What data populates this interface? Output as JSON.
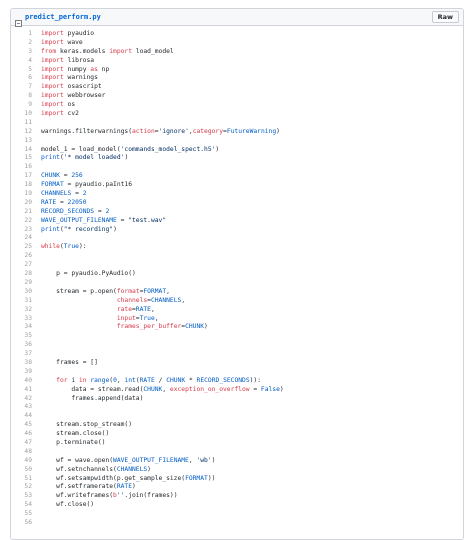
{
  "file": {
    "name": "predict_perform.py",
    "raw_label": "Raw"
  },
  "colors": {
    "keyword": "#d73a49",
    "constant": "#005cc5",
    "string": "#032f62",
    "text": "#24292e",
    "filename": "#0366d6"
  },
  "code_lines": [
    {
      "n": "1",
      "t": [
        {
          "k": "k",
          "s": "import"
        },
        {
          "k": "",
          "s": " pyaudio"
        }
      ]
    },
    {
      "n": "2",
      "t": [
        {
          "k": "k",
          "s": "import"
        },
        {
          "k": "",
          "s": " wave"
        }
      ]
    },
    {
      "n": "3",
      "t": [
        {
          "k": "k",
          "s": "from"
        },
        {
          "k": "",
          "s": " keras.models "
        },
        {
          "k": "k",
          "s": "import"
        },
        {
          "k": "",
          "s": " load_model"
        }
      ]
    },
    {
      "n": "4",
      "t": [
        {
          "k": "k",
          "s": "import"
        },
        {
          "k": "",
          "s": " librosa"
        }
      ]
    },
    {
      "n": "5",
      "t": [
        {
          "k": "k",
          "s": "import"
        },
        {
          "k": "",
          "s": " numpy "
        },
        {
          "k": "k",
          "s": "as"
        },
        {
          "k": "",
          "s": " np"
        }
      ]
    },
    {
      "n": "6",
      "t": [
        {
          "k": "k",
          "s": "import"
        },
        {
          "k": "",
          "s": " warnings"
        }
      ]
    },
    {
      "n": "7",
      "t": [
        {
          "k": "k",
          "s": "import"
        },
        {
          "k": "",
          "s": " osascript"
        }
      ]
    },
    {
      "n": "8",
      "t": [
        {
          "k": "k",
          "s": "import"
        },
        {
          "k": "",
          "s": " webbrowser"
        }
      ]
    },
    {
      "n": "9",
      "t": [
        {
          "k": "k",
          "s": "import"
        },
        {
          "k": "",
          "s": " os"
        }
      ]
    },
    {
      "n": "10",
      "t": [
        {
          "k": "k",
          "s": "import"
        },
        {
          "k": "",
          "s": " cv2"
        }
      ]
    },
    {
      "n": "11",
      "t": []
    },
    {
      "n": "12",
      "t": [
        {
          "k": "",
          "s": "warnings.filterwarnings("
        },
        {
          "k": "k",
          "s": "action"
        },
        {
          "k": "",
          "s": "="
        },
        {
          "k": "s",
          "s": "'ignore'"
        },
        {
          "k": "",
          "s": ","
        },
        {
          "k": "k",
          "s": "category"
        },
        {
          "k": "",
          "s": "="
        },
        {
          "k": "c",
          "s": "FutureWarning"
        },
        {
          "k": "",
          "s": ")"
        }
      ]
    },
    {
      "n": "13",
      "t": []
    },
    {
      "n": "14",
      "t": [
        {
          "k": "",
          "s": "model_1 = load_model("
        },
        {
          "k": "s",
          "s": "'commands_model_spect.h5'"
        },
        {
          "k": "",
          "s": ")"
        }
      ]
    },
    {
      "n": "15",
      "t": [
        {
          "k": "c",
          "s": "print"
        },
        {
          "k": "",
          "s": "("
        },
        {
          "k": "s",
          "s": "'* model loaded'"
        },
        {
          "k": "",
          "s": ")"
        }
      ]
    },
    {
      "n": "16",
      "t": []
    },
    {
      "n": "17",
      "t": [
        {
          "k": "c",
          "s": "CHUNK"
        },
        {
          "k": "",
          "s": " = "
        },
        {
          "k": "c",
          "s": "256"
        }
      ]
    },
    {
      "n": "18",
      "t": [
        {
          "k": "c",
          "s": "FORMAT"
        },
        {
          "k": "",
          "s": " = pyaudio.paInt16"
        }
      ]
    },
    {
      "n": "19",
      "t": [
        {
          "k": "c",
          "s": "CHANNELS"
        },
        {
          "k": "",
          "s": " = "
        },
        {
          "k": "c",
          "s": "2"
        }
      ]
    },
    {
      "n": "20",
      "t": [
        {
          "k": "c",
          "s": "RATE"
        },
        {
          "k": "",
          "s": " = "
        },
        {
          "k": "c",
          "s": "22050"
        }
      ]
    },
    {
      "n": "21",
      "t": [
        {
          "k": "c",
          "s": "RECORD_SECONDS"
        },
        {
          "k": "",
          "s": " = "
        },
        {
          "k": "c",
          "s": "2"
        }
      ]
    },
    {
      "n": "22",
      "t": [
        {
          "k": "c",
          "s": "WAVE_OUTPUT_FILENAME"
        },
        {
          "k": "",
          "s": " = "
        },
        {
          "k": "s",
          "s": "\"test.wav\""
        }
      ]
    },
    {
      "n": "23",
      "t": [
        {
          "k": "c",
          "s": "print"
        },
        {
          "k": "",
          "s": "("
        },
        {
          "k": "s",
          "s": "\"* recording\""
        },
        {
          "k": "",
          "s": ")"
        }
      ]
    },
    {
      "n": "24",
      "t": []
    },
    {
      "n": "25",
      "t": [
        {
          "k": "k",
          "s": "while"
        },
        {
          "k": "",
          "s": "("
        },
        {
          "k": "c",
          "s": "True"
        },
        {
          "k": "",
          "s": "):"
        }
      ]
    },
    {
      "n": "26",
      "t": []
    },
    {
      "n": "27",
      "t": []
    },
    {
      "n": "28",
      "t": [
        {
          "k": "",
          "s": "    p = pyaudio.PyAudio()"
        }
      ]
    },
    {
      "n": "29",
      "t": []
    },
    {
      "n": "30",
      "t": [
        {
          "k": "",
          "s": "    stream = p.open("
        },
        {
          "k": "k",
          "s": "format"
        },
        {
          "k": "",
          "s": "="
        },
        {
          "k": "c",
          "s": "FORMAT"
        },
        {
          "k": "",
          "s": ","
        }
      ]
    },
    {
      "n": "31",
      "t": [
        {
          "k": "",
          "s": "                    "
        },
        {
          "k": "k",
          "s": "channels"
        },
        {
          "k": "",
          "s": "="
        },
        {
          "k": "c",
          "s": "CHANNELS"
        },
        {
          "k": "",
          "s": ","
        }
      ]
    },
    {
      "n": "32",
      "t": [
        {
          "k": "",
          "s": "                    "
        },
        {
          "k": "k",
          "s": "rate"
        },
        {
          "k": "",
          "s": "="
        },
        {
          "k": "c",
          "s": "RATE"
        },
        {
          "k": "",
          "s": ","
        }
      ]
    },
    {
      "n": "33",
      "t": [
        {
          "k": "",
          "s": "                    "
        },
        {
          "k": "k",
          "s": "input"
        },
        {
          "k": "",
          "s": "="
        },
        {
          "k": "c",
          "s": "True"
        },
        {
          "k": "",
          "s": ","
        }
      ]
    },
    {
      "n": "34",
      "t": [
        {
          "k": "",
          "s": "                    "
        },
        {
          "k": "k",
          "s": "frames_per_buffer"
        },
        {
          "k": "",
          "s": "="
        },
        {
          "k": "c",
          "s": "CHUNK"
        },
        {
          "k": "",
          "s": ")"
        }
      ]
    },
    {
      "n": "35",
      "t": []
    },
    {
      "n": "36",
      "t": []
    },
    {
      "n": "37",
      "t": []
    },
    {
      "n": "38",
      "t": [
        {
          "k": "",
          "s": "    frames = []"
        }
      ]
    },
    {
      "n": "39",
      "t": []
    },
    {
      "n": "40",
      "t": [
        {
          "k": "",
          "s": "    "
        },
        {
          "k": "k",
          "s": "for"
        },
        {
          "k": "",
          "s": " i "
        },
        {
          "k": "k",
          "s": "in"
        },
        {
          "k": "",
          "s": " "
        },
        {
          "k": "c",
          "s": "range"
        },
        {
          "k": "",
          "s": "("
        },
        {
          "k": "c",
          "s": "0"
        },
        {
          "k": "",
          "s": ", "
        },
        {
          "k": "c",
          "s": "int"
        },
        {
          "k": "",
          "s": "("
        },
        {
          "k": "c",
          "s": "RATE"
        },
        {
          "k": "",
          "s": " / "
        },
        {
          "k": "c",
          "s": "CHUNK"
        },
        {
          "k": "",
          "s": " * "
        },
        {
          "k": "c",
          "s": "RECORD_SECONDS"
        },
        {
          "k": "",
          "s": ")):"
        }
      ]
    },
    {
      "n": "41",
      "t": [
        {
          "k": "",
          "s": "        data = stream.read("
        },
        {
          "k": "c",
          "s": "CHUNK"
        },
        {
          "k": "",
          "s": ", "
        },
        {
          "k": "k",
          "s": "exception_on_overflow"
        },
        {
          "k": "",
          "s": " = "
        },
        {
          "k": "c",
          "s": "False"
        },
        {
          "k": "",
          "s": ")"
        }
      ]
    },
    {
      "n": "42",
      "t": [
        {
          "k": "",
          "s": "        frames.append(data)"
        }
      ]
    },
    {
      "n": "43",
      "t": []
    },
    {
      "n": "44",
      "t": []
    },
    {
      "n": "45",
      "t": [
        {
          "k": "",
          "s": "    stream.stop_stream()"
        }
      ]
    },
    {
      "n": "46",
      "t": [
        {
          "k": "",
          "s": "    stream.close()"
        }
      ]
    },
    {
      "n": "47",
      "t": [
        {
          "k": "",
          "s": "    p.terminate()"
        }
      ]
    },
    {
      "n": "48",
      "t": []
    },
    {
      "n": "49",
      "t": [
        {
          "k": "",
          "s": "    wf = wave.open("
        },
        {
          "k": "c",
          "s": "WAVE_OUTPUT_FILENAME"
        },
        {
          "k": "",
          "s": ", "
        },
        {
          "k": "s",
          "s": "'wb'"
        },
        {
          "k": "",
          "s": ")"
        }
      ]
    },
    {
      "n": "50",
      "t": [
        {
          "k": "",
          "s": "    wf.setnchannels("
        },
        {
          "k": "c",
          "s": "CHANNELS"
        },
        {
          "k": "",
          "s": ")"
        }
      ]
    },
    {
      "n": "51",
      "t": [
        {
          "k": "",
          "s": "    wf.setsampwidth(p.get_sample_size("
        },
        {
          "k": "c",
          "s": "FORMAT"
        },
        {
          "k": "",
          "s": "))"
        }
      ]
    },
    {
      "n": "52",
      "t": [
        {
          "k": "",
          "s": "    wf.setframerate("
        },
        {
          "k": "c",
          "s": "RATE"
        },
        {
          "k": "",
          "s": ")"
        }
      ]
    },
    {
      "n": "53",
      "t": [
        {
          "k": "",
          "s": "    wf.writeframes("
        },
        {
          "k": "k",
          "s": "b"
        },
        {
          "k": "s",
          "s": "''"
        },
        {
          "k": "",
          "s": ".join(frames))"
        }
      ]
    },
    {
      "n": "54",
      "t": [
        {
          "k": "",
          "s": "    wf.close()"
        }
      ]
    },
    {
      "n": "55",
      "t": []
    },
    {
      "n": "56",
      "t": []
    }
  ]
}
